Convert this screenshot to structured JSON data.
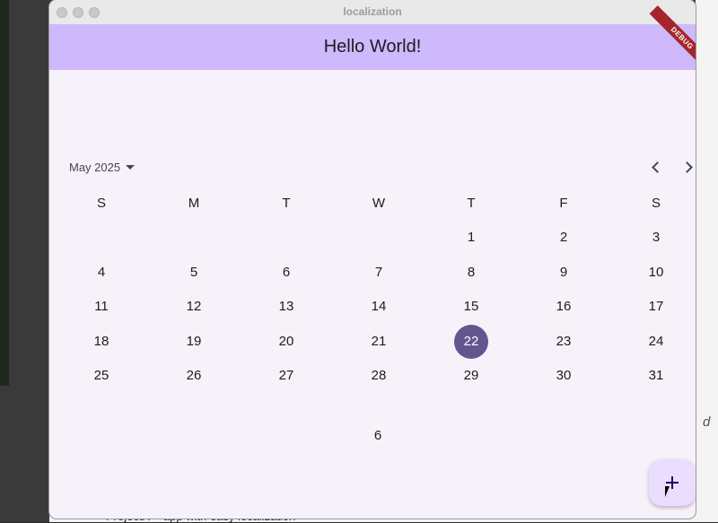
{
  "window": {
    "title": "localization"
  },
  "appbar": {
    "title": "Hello World!",
    "debug_label": "DEBUG"
  },
  "calendar": {
    "month_label": "May 2025",
    "weekdays": [
      "S",
      "M",
      "T",
      "W",
      "T",
      "F",
      "S"
    ],
    "weeks": [
      [
        "",
        "",
        "",
        "",
        "1",
        "2",
        "3"
      ],
      [
        "4",
        "5",
        "6",
        "7",
        "8",
        "9",
        "10"
      ],
      [
        "11",
        "12",
        "13",
        "14",
        "15",
        "16",
        "17"
      ],
      [
        "18",
        "19",
        "20",
        "21",
        "22",
        "23",
        "24"
      ],
      [
        "25",
        "26",
        "27",
        "28",
        "29",
        "30",
        "31"
      ]
    ],
    "selected_day": "22",
    "extra_label": "6"
  },
  "background": {
    "right_fragment": "d",
    "bottom_text": "ProjectX > app with easy localization"
  },
  "colors": {
    "appbar_bg": "#cdb9fb",
    "selected": "#65558f",
    "fab_bg": "#eaddff",
    "surface": "#f7f1fa"
  },
  "icons": {
    "month_dropdown": "caret-down-icon",
    "prev": "chevron-left-icon",
    "next": "chevron-right-icon",
    "fab": "plus-icon"
  }
}
